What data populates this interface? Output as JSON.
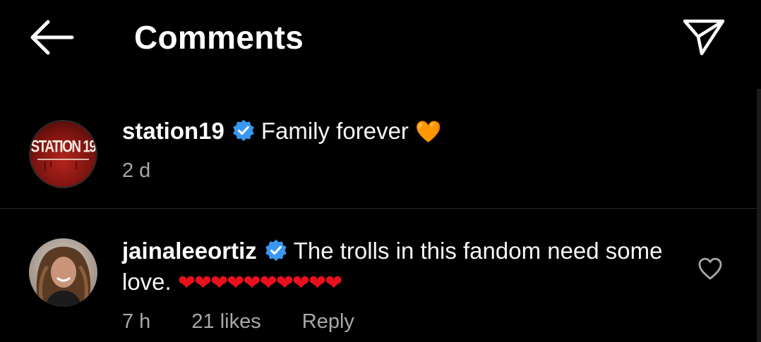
{
  "header": {
    "title": "Comments",
    "back_icon": "arrow-left-icon",
    "share_icon": "paper-plane-icon"
  },
  "colors": {
    "background": "#000000",
    "text": "#ffffff",
    "muted": "#a8a8a8",
    "verified": "#3897f0",
    "divider": "#262626"
  },
  "comments": [
    {
      "avatar_text": "STATION 19",
      "username": "station19",
      "verified": true,
      "text": "Family forever",
      "emoji": "🧡",
      "time": "2 d"
    },
    {
      "username": "jainaleeortiz",
      "verified": true,
      "text": "The trolls in this fandom need some love.",
      "emoji": "❤❤❤❤❤❤❤❤❤❤",
      "time": "7 h",
      "likes": "21 likes",
      "reply_label": "Reply"
    }
  ]
}
